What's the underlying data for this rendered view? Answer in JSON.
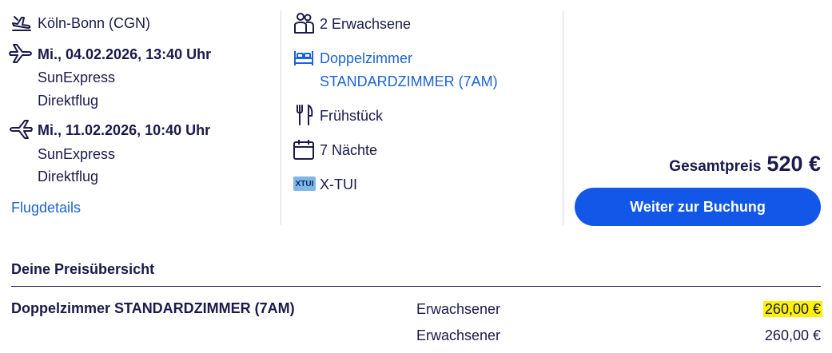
{
  "flight": {
    "departure_airport": "Köln-Bonn (CGN)",
    "outbound": {
      "datetime": "Mi., 04.02.2026, 13:40 Uhr",
      "airline": "SunExpress",
      "type": "Direktflug"
    },
    "return": {
      "datetime": "Mi., 11.02.2026, 10:40 Uhr",
      "airline": "SunExpress",
      "type": "Direktflug"
    },
    "details_link": "Flugdetails"
  },
  "hotel": {
    "travellers": "2 Erwachsene",
    "room_type": "Doppelzimmer",
    "room_name": "STANDARDZIMMER (7AM)",
    "board": "Frühstück",
    "nights": "7 Nächte",
    "brand_badge": "XTUI",
    "brand": "X-TUI"
  },
  "booking": {
    "total_label": "Gesamtpreis",
    "total_price": "520 €",
    "continue_button": "Weiter zur Buchung",
    "accent_color": "#1257e8"
  },
  "price_overview": {
    "title": "Deine Preisübersicht",
    "rows": [
      {
        "item": "Doppelzimmer STANDARDZIMMER (7AM)",
        "type": "Erwachsener",
        "price": "260,00 €",
        "highlighted": true
      },
      {
        "item": "",
        "type": "Erwachsener",
        "price": "260,00 €",
        "highlighted": false
      }
    ]
  }
}
